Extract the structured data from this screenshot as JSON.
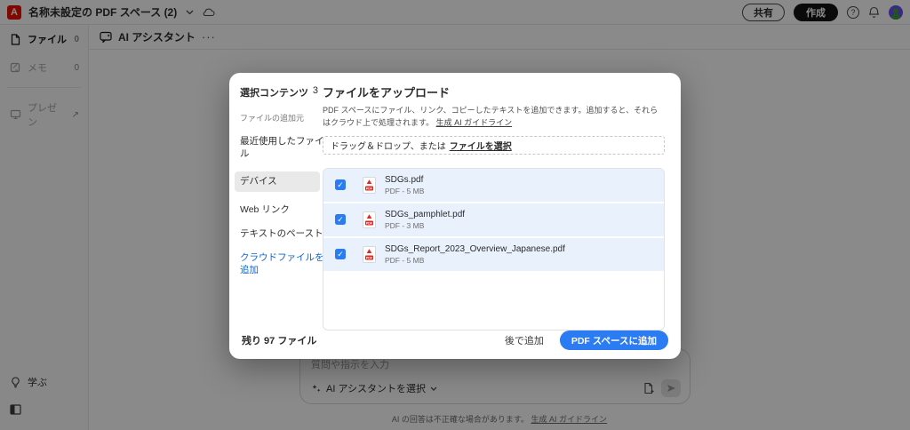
{
  "topbar": {
    "title": "名称未設定の PDF スペース (2)",
    "share_label": "共有",
    "create_label": "作成",
    "help_glyph": "?"
  },
  "sidebar": {
    "items": [
      {
        "label": "ファイル",
        "count": "0"
      },
      {
        "label": "メモ",
        "count": "0"
      },
      {
        "label": "プレゼン"
      }
    ],
    "learn_label": "学ぶ"
  },
  "main": {
    "header_title": "AI アシスタント",
    "more_glyph": "···",
    "chat": {
      "placeholder": "質問や指示を入力",
      "assistant_selector": "AI アシスタントを選択"
    },
    "footer_note": "AI の回答は不正確な場合があります。",
    "footer_link": "生成 AI ガイドライン"
  },
  "modal": {
    "selected_label": "選択コンテンツ",
    "selected_count": "3",
    "source_label": "ファイルの追加元",
    "nav": {
      "recent": "最近使用したファイル",
      "device": "デバイス",
      "weblink": "Web リンク",
      "paste": "テキストのペースト",
      "cloud": "クラウドファイルを追加"
    },
    "title": "ファイルをアップロード",
    "description": "PDF スペースにファイル、リンク、コピーしたテキストを追加できます。追加すると、それらはクラウド上で処理されます。",
    "description_link": "生成 AI ガイドライン",
    "dropzone_text": "ドラッグ＆ドロップ、または",
    "dropzone_link": "ファイルを選択",
    "checkbox_glyph": "✓",
    "files": [
      {
        "name": "SDGs.pdf",
        "meta": "PDF - 5 MB",
        "checked": true
      },
      {
        "name": "SDGs_pamphlet.pdf",
        "meta": "PDF - 3 MB",
        "checked": true
      },
      {
        "name": "SDGs_Report_2023_Overview_Japanese.pdf",
        "meta": "PDF - 5 MB",
        "checked": true
      }
    ],
    "remaining_label": "残り 97 ファイル",
    "later_button": "後で追加",
    "add_button": "PDF スペースに追加"
  },
  "colors": {
    "accent_blue": "#2b7bf3",
    "row_highlight": "#e9f1fc",
    "link_blue": "#0e66d0",
    "brand_red": "#eb1000",
    "create_button_bg": "#131313",
    "overlay": "rgba(0,0,0,0.46)"
  }
}
